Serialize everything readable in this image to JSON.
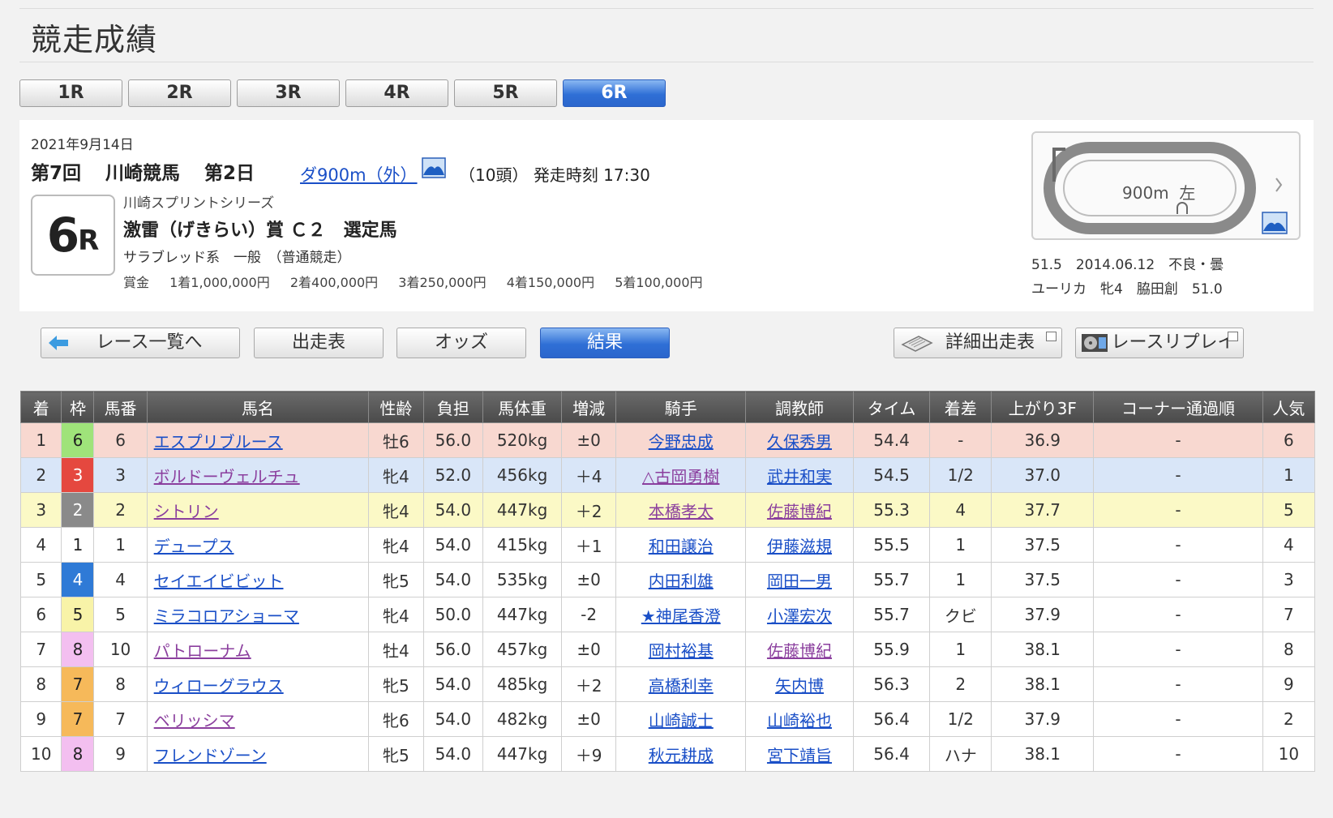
{
  "page_title": "競走成績",
  "race_tabs": [
    {
      "label": "1R",
      "active": false
    },
    {
      "label": "2R",
      "active": false
    },
    {
      "label": "3R",
      "active": false
    },
    {
      "label": "4R",
      "active": false
    },
    {
      "label": "5R",
      "active": false
    },
    {
      "label": "6R",
      "active": true
    }
  ],
  "race_info": {
    "date": "2021年9月14日",
    "kai": "第7回",
    "venue": "川崎競馬",
    "day": "第2日",
    "course": "ダ900m（外）",
    "heads": "（10頭）",
    "start_time": "発走時刻 17:30",
    "race_num": "6",
    "race_r": "R",
    "series": "川崎スプリントシリーズ",
    "race_name": "激雷（げきらい）賞 Ｃ２　選定馬",
    "condition": "サラブレッド系　一般　（普通競走）",
    "prize_label": "賞金",
    "prizes": [
      "1着1,000,000円",
      "2着400,000円",
      "3着250,000円",
      "4着150,000円",
      "5着100,000円"
    ]
  },
  "course_map": {
    "distance": "900m",
    "direction": "左"
  },
  "record": {
    "line1": "51.5　2014.06.12　不良・曇",
    "line2": "ユーリカ　牝4　脇田創　51.0"
  },
  "nav_buttons": {
    "back": "レース一覧へ",
    "entries": "出走表",
    "odds": "オッズ",
    "results": "結果",
    "detailed": "詳細出走表",
    "replay": "レースリプレイ"
  },
  "table": {
    "headers": [
      "着",
      "枠",
      "馬番",
      "馬名",
      "性齢",
      "負担",
      "馬体重",
      "増減",
      "騎手",
      "調教師",
      "タイム",
      "着差",
      "上がり3F",
      "コーナー通過順",
      "人気"
    ],
    "rows": [
      {
        "pos": "1",
        "waku": "6",
        "num": "6",
        "horse": "エスプリブルース",
        "sexage": "牡6",
        "weight": "56.0",
        "body": "520kg",
        "diff": "±0",
        "jockey": "今野忠成",
        "trainer": "久保秀男",
        "time": "54.4",
        "margin": "-",
        "last3f": "36.9",
        "corner": "-",
        "pop": "6"
      },
      {
        "pos": "2",
        "waku": "3",
        "num": "3",
        "horse": "ボルドーヴェルチュ",
        "sexage": "牝4",
        "weight": "52.0",
        "body": "456kg",
        "diff": "＋4",
        "jockey": "△古岡勇樹",
        "trainer": "武井和実",
        "time": "54.5",
        "margin": "1/2",
        "last3f": "37.0",
        "corner": "-",
        "pop": "1"
      },
      {
        "pos": "3",
        "waku": "2",
        "num": "2",
        "horse": "シトリン",
        "sexage": "牝4",
        "weight": "54.0",
        "body": "447kg",
        "diff": "＋2",
        "jockey": "本橋孝太",
        "trainer": "佐藤博紀",
        "time": "55.3",
        "margin": "4",
        "last3f": "37.7",
        "corner": "-",
        "pop": "5"
      },
      {
        "pos": "4",
        "waku": "1",
        "num": "1",
        "horse": "デュープス",
        "sexage": "牝4",
        "weight": "54.0",
        "body": "415kg",
        "diff": "＋1",
        "jockey": "和田譲治",
        "trainer": "伊藤滋規",
        "time": "55.5",
        "margin": "1",
        "last3f": "37.5",
        "corner": "-",
        "pop": "4"
      },
      {
        "pos": "5",
        "waku": "4",
        "num": "4",
        "horse": "セイエイビビット",
        "sexage": "牝5",
        "weight": "54.0",
        "body": "535kg",
        "diff": "±0",
        "jockey": "内田利雄",
        "trainer": "岡田一男",
        "time": "55.7",
        "margin": "1",
        "last3f": "37.5",
        "corner": "-",
        "pop": "3"
      },
      {
        "pos": "6",
        "waku": "5",
        "num": "5",
        "horse": "ミラコロアショーマ",
        "sexage": "牝4",
        "weight": "50.0",
        "body": "447kg",
        "diff": "-2",
        "jockey": "★神尾香澄",
        "trainer": "小澤宏次",
        "time": "55.7",
        "margin": "クビ",
        "last3f": "37.9",
        "corner": "-",
        "pop": "7"
      },
      {
        "pos": "7",
        "waku": "8",
        "num": "10",
        "horse": "パトローナム",
        "sexage": "牡4",
        "weight": "56.0",
        "body": "457kg",
        "diff": "±0",
        "jockey": "岡村裕基",
        "trainer": "佐藤博紀",
        "time": "55.9",
        "margin": "1",
        "last3f": "38.1",
        "corner": "-",
        "pop": "8"
      },
      {
        "pos": "8",
        "waku": "7",
        "num": "8",
        "horse": "ウィローグラウス",
        "sexage": "牝5",
        "weight": "54.0",
        "body": "485kg",
        "diff": "＋2",
        "jockey": "高橋利幸",
        "trainer": "矢内博",
        "time": "56.3",
        "margin": "2",
        "last3f": "38.1",
        "corner": "-",
        "pop": "9"
      },
      {
        "pos": "9",
        "waku": "7",
        "num": "7",
        "horse": "ベリッシマ",
        "sexage": "牝6",
        "weight": "54.0",
        "body": "482kg",
        "diff": "±0",
        "jockey": "山崎誠士",
        "trainer": "山崎裕也",
        "time": "56.4",
        "margin": "1/2",
        "last3f": "37.9",
        "corner": "-",
        "pop": "2"
      },
      {
        "pos": "10",
        "waku": "8",
        "num": "9",
        "horse": "フレンドゾーン",
        "sexage": "牝5",
        "weight": "54.0",
        "body": "447kg",
        "diff": "＋9",
        "jockey": "秋元耕成",
        "trainer": "宮下靖旨",
        "time": "56.4",
        "margin": "ハナ",
        "last3f": "38.1",
        "corner": "-",
        "pop": "10"
      }
    ]
  },
  "waku_colors": {
    "1": {
      "bg": "#ffffff",
      "fg": "#222222"
    },
    "2": {
      "bg": "#8a8a8a",
      "fg": "#ffffff"
    },
    "3": {
      "bg": "#e5483f",
      "fg": "#ffffff"
    },
    "4": {
      "bg": "#2f7ad6",
      "fg": "#ffffff"
    },
    "5": {
      "bg": "#f8f3a8",
      "fg": "#222222"
    },
    "6": {
      "bg": "#9fe37a",
      "fg": "#222222"
    },
    "7": {
      "bg": "#f6b95a",
      "fg": "#222222"
    },
    "8": {
      "bg": "#f3bff0",
      "fg": "#222222"
    }
  },
  "colors": {
    "accent": "#2f6fd6",
    "link": "#1a4fc7",
    "link_visited": "#8b3f9e",
    "row1": "#f8d8d0",
    "row2": "#d9e6f8",
    "row3": "#fbf9c6"
  }
}
